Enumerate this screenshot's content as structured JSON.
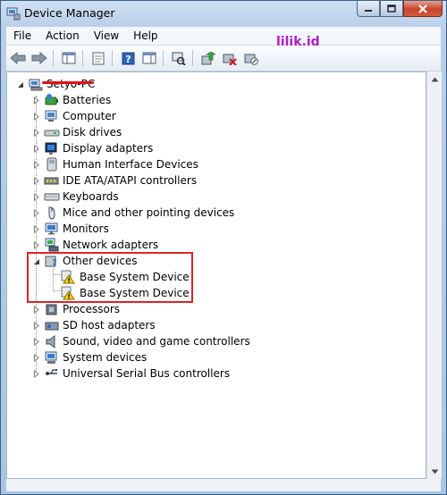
{
  "window": {
    "title": "Device Manager"
  },
  "watermark": "lilik.id",
  "menu": [
    "File",
    "Action",
    "View",
    "Help"
  ],
  "tree": {
    "root": "Setyo-PC",
    "categories": [
      {
        "label": "Batteries",
        "icon": "battery-icon"
      },
      {
        "label": "Computer",
        "icon": "computer-icon"
      },
      {
        "label": "Disk drives",
        "icon": "disk-drive-icon"
      },
      {
        "label": "Display adapters",
        "icon": "display-adapter-icon"
      },
      {
        "label": "Human Interface Devices",
        "icon": "hid-icon"
      },
      {
        "label": "IDE ATA/ATAPI controllers",
        "icon": "ide-controller-icon"
      },
      {
        "label": "Keyboards",
        "icon": "keyboard-icon"
      },
      {
        "label": "Mice and other pointing devices",
        "icon": "mouse-icon"
      },
      {
        "label": "Monitors",
        "icon": "monitor-icon"
      },
      {
        "label": "Network adapters",
        "icon": "network-adapter-icon"
      },
      {
        "label": "Other devices",
        "icon": "unknown-device-icon",
        "expanded": true,
        "children": [
          "Base System Device",
          "Base System Device"
        ]
      },
      {
        "label": "Processors",
        "icon": "processor-icon"
      },
      {
        "label": "SD host adapters",
        "icon": "sd-host-icon"
      },
      {
        "label": "Sound, video and game controllers",
        "icon": "speaker-icon"
      },
      {
        "label": "System devices",
        "icon": "system-device-icon"
      },
      {
        "label": "Universal Serial Bus controllers",
        "icon": "usb-icon"
      }
    ]
  }
}
